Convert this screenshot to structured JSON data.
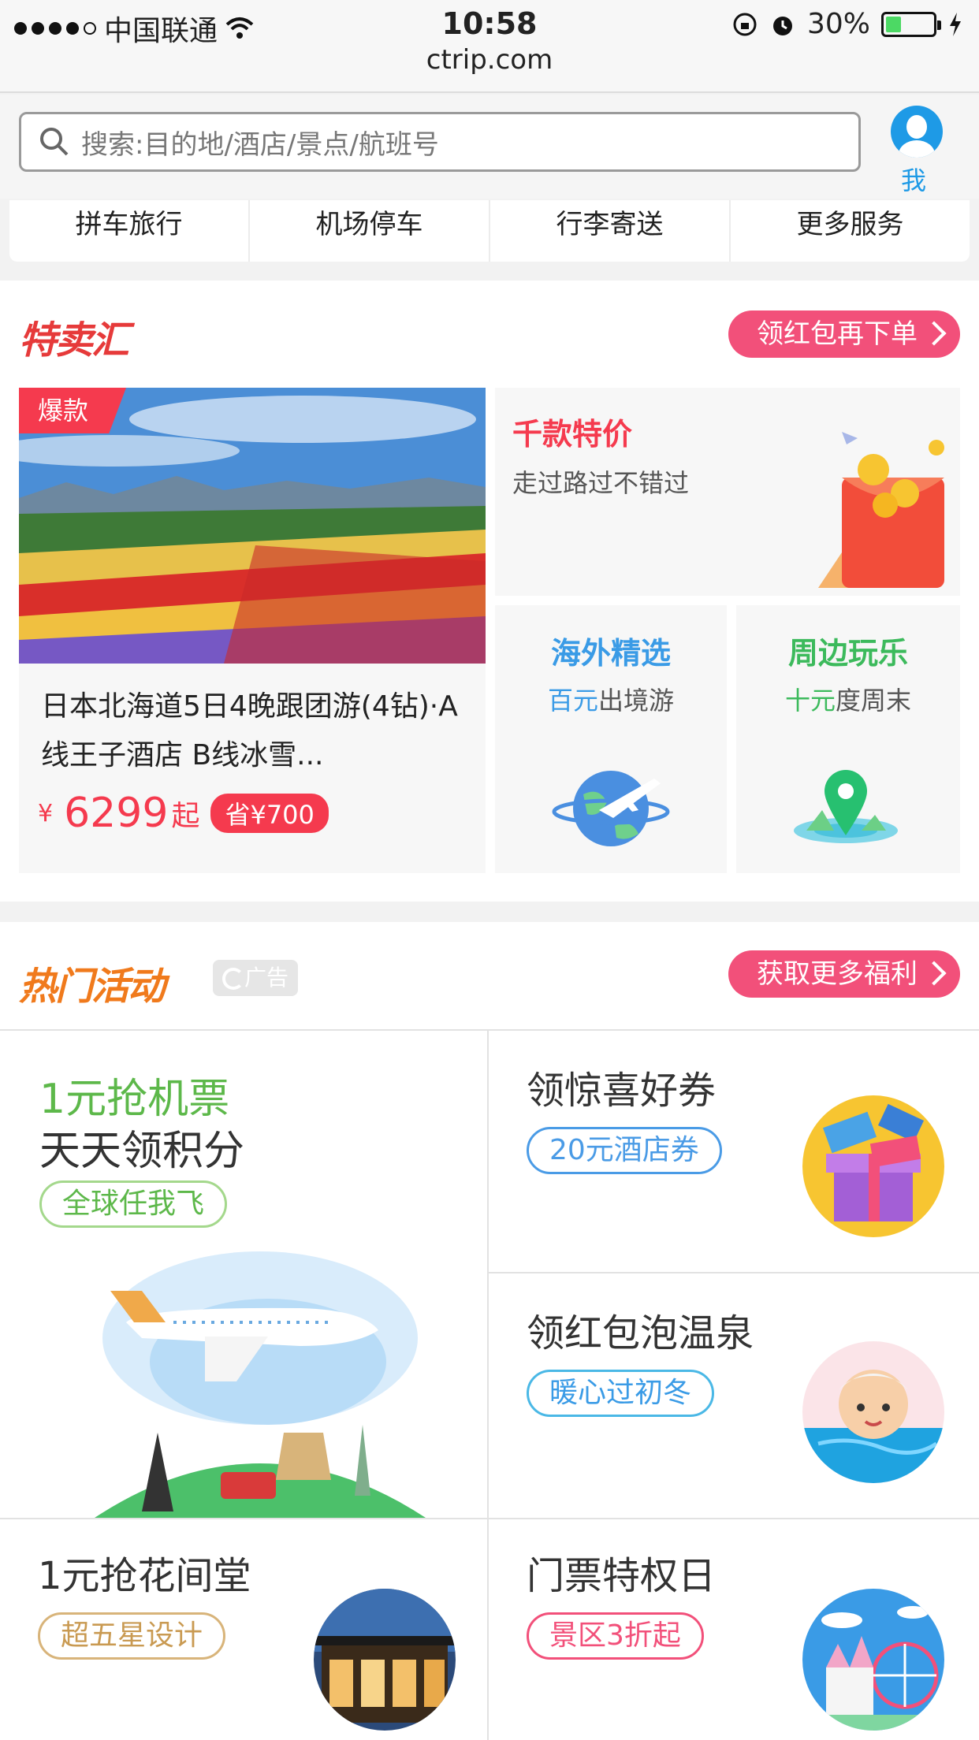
{
  "status_bar": {
    "carrier": "中国联通",
    "time": "10:58",
    "battery": "30%"
  },
  "url": "ctrip.com",
  "search": {
    "placeholder": "搜索:目的地/酒店/景点/航班号"
  },
  "profile": {
    "label": "我 的"
  },
  "services": [
    "拼车旅行",
    "机场停车",
    "行李寄送",
    "更多服务"
  ],
  "deals": {
    "logo": "特卖汇",
    "action": "领红包再下单",
    "featured": {
      "badge": "爆款",
      "title": "日本北海道5日4晚跟团游(4钻)·A线王子酒店 B线冰雪...",
      "currency": "¥",
      "price": "6299",
      "price_suffix": "起",
      "save": "省¥700"
    },
    "promo1": {
      "title": "千款特价",
      "subtitle": "走过路过不错过"
    },
    "promo2": {
      "title": "海外精选",
      "highlight": "百元",
      "subtitle": "出境游"
    },
    "promo3": {
      "title": "周边玩乐",
      "highlight": "十元",
      "subtitle": "度周末"
    }
  },
  "activities": {
    "logo": "热门活动",
    "ad_label": "广告",
    "action": "获取更多福利",
    "big_card": {
      "line1": "1元抢机票",
      "line2": "天天领积分",
      "tag": "全球任我飞"
    },
    "card1": {
      "title": "领惊喜好券",
      "tag": "20元酒店券"
    },
    "card2": {
      "title": "领红包泡温泉",
      "tag": "暖心过初冬"
    },
    "card3": {
      "title": "1元抢花间堂",
      "tag": "超五星设计"
    },
    "card4": {
      "title": "门票特权日",
      "tag": "景区3折起"
    }
  },
  "colors": {
    "accent": "#f2507a",
    "red": "#f53a4e",
    "blue": "#3a9be6",
    "green": "#3cba5c",
    "logo_red": "#e63a3a",
    "logo_orange": "#f07a1c"
  }
}
